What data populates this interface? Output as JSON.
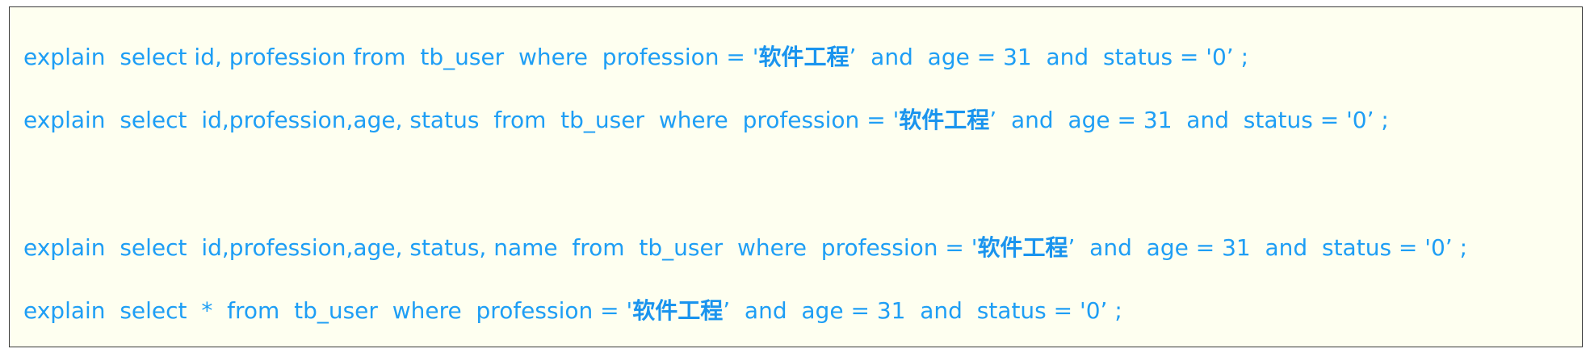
{
  "lines": [
    {
      "before": "explain  select id, profession from  tb_user  where  profession = '",
      "value": "软件工程",
      "after": "’  and  age = 31  and  status = '0’ ;"
    },
    {
      "before": "explain  select  id,profession,age, status  from  tb_user  where  profession = '",
      "value": "软件工程",
      "after": "’  and  age = 31  and  status = '0’ ;"
    },
    {
      "before": "explain  select  id,profession,age, status, name  from  tb_user  where  profession = '",
      "value": "软件工程",
      "after": "’  and  age = 31  and  status = '0’ ;"
    },
    {
      "before": "explain  select  *  from  tb_user  where  profession = '",
      "value": "软件工程",
      "after": "’  and  age = 31  and  status = '0’ ;"
    }
  ],
  "colors": {
    "text": "#1e9ef5",
    "box_background": "#fefff0",
    "box_border": "#3a3a3a"
  }
}
